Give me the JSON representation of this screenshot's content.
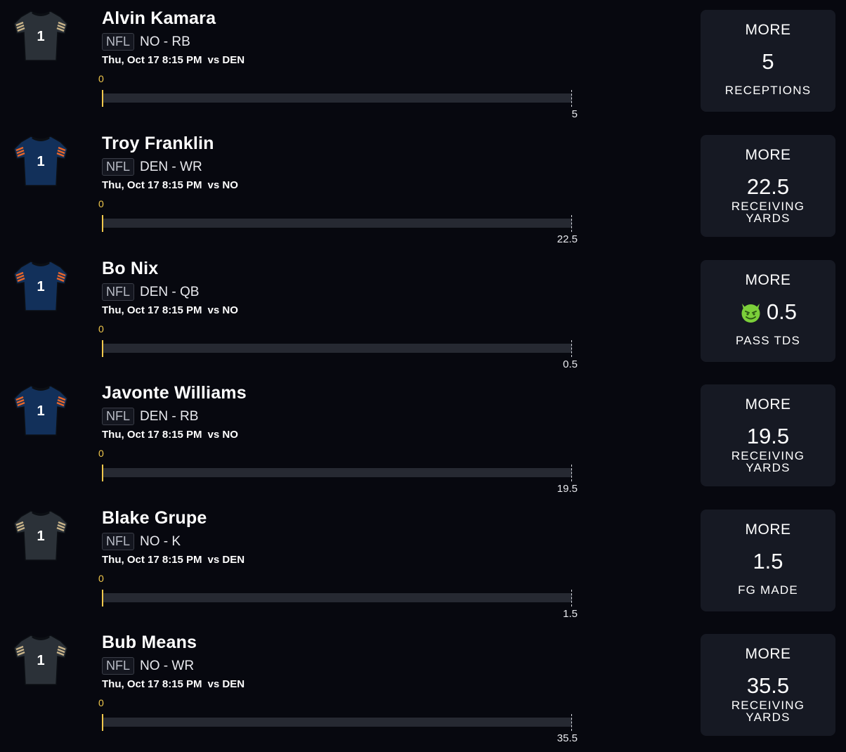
{
  "props": [
    {
      "player": "Alvin Kamara",
      "league": "NFL",
      "team_pos": "NO - RB",
      "game_time": "Thu, Oct 17 8:15 PM",
      "opponent": "vs DEN",
      "progress_start": "0",
      "current_value": 0,
      "target": "5",
      "direction": "MORE",
      "line": "5",
      "stat_line1": "RECEPTIONS",
      "stat_line2": "",
      "jersey_color": "#2b3138",
      "jersey_trim": "#c9b48a",
      "jersey_number": "1",
      "has_demon": false
    },
    {
      "player": "Troy Franklin",
      "league": "NFL",
      "team_pos": "DEN - WR",
      "game_time": "Thu, Oct 17 8:15 PM",
      "opponent": "vs NO",
      "progress_start": "0",
      "current_value": 0,
      "target": "22.5",
      "direction": "MORE",
      "line": "22.5",
      "stat_line1": "RECEIVING",
      "stat_line2": "YARDS",
      "jersey_color": "#12305a",
      "jersey_trim": "#e8662a",
      "jersey_number": "1",
      "has_demon": false
    },
    {
      "player": "Bo Nix",
      "league": "NFL",
      "team_pos": "DEN - QB",
      "game_time": "Thu, Oct 17 8:15 PM",
      "opponent": "vs NO",
      "progress_start": "0",
      "current_value": 0,
      "target": "0.5",
      "direction": "MORE",
      "line": "0.5",
      "stat_line1": "PASS TDS",
      "stat_line2": "",
      "jersey_color": "#12305a",
      "jersey_trim": "#e8662a",
      "jersey_number": "1",
      "has_demon": true
    },
    {
      "player": "Javonte Williams",
      "league": "NFL",
      "team_pos": "DEN - RB",
      "game_time": "Thu, Oct 17 8:15 PM",
      "opponent": "vs NO",
      "progress_start": "0",
      "current_value": 0,
      "target": "19.5",
      "direction": "MORE",
      "line": "19.5",
      "stat_line1": "RECEIVING",
      "stat_line2": "YARDS",
      "jersey_color": "#12305a",
      "jersey_trim": "#e8662a",
      "jersey_number": "1",
      "has_demon": false
    },
    {
      "player": "Blake Grupe",
      "league": "NFL",
      "team_pos": "NO - K",
      "game_time": "Thu, Oct 17 8:15 PM",
      "opponent": "vs DEN",
      "progress_start": "0",
      "current_value": 0,
      "target": "1.5",
      "direction": "MORE",
      "line": "1.5",
      "stat_line1": "FG MADE",
      "stat_line2": "",
      "jersey_color": "#2b3138",
      "jersey_trim": "#c9b48a",
      "jersey_number": "1",
      "has_demon": false
    },
    {
      "player": "Bub Means",
      "league": "NFL",
      "team_pos": "NO - WR",
      "game_time": "Thu, Oct 17 8:15 PM",
      "opponent": "vs DEN",
      "progress_start": "0",
      "current_value": 0,
      "target": "35.5",
      "direction": "MORE",
      "line": "35.5",
      "stat_line1": "RECEIVING",
      "stat_line2": "YARDS",
      "jersey_color": "#2b3138",
      "jersey_trim": "#c9b48a",
      "jersey_number": "1",
      "has_demon": false
    }
  ],
  "colors": {
    "background": "#07080f",
    "card": "#161923",
    "accent_yellow": "#f2c94c",
    "track": "#262932",
    "demon_green": "#7ccf3a"
  }
}
